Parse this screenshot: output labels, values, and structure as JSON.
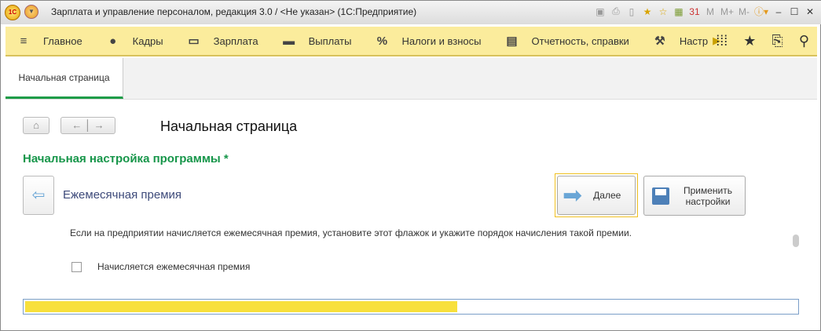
{
  "window": {
    "logo": "1С",
    "title": "Зарплата и управление персоналом, редакция 3.0 / <Не указан>  (1С:Предприятие)",
    "toolbar": [
      "M",
      "M+",
      "M-"
    ]
  },
  "sections": [
    {
      "icon": "menu-icon",
      "glyph": "≡",
      "label": "Главное"
    },
    {
      "icon": "people-icon",
      "glyph": "👥",
      "label": "Кадры"
    },
    {
      "icon": "card-icon",
      "glyph": "▭",
      "label": "Зарплата"
    },
    {
      "icon": "wallet-icon",
      "glyph": "▬",
      "label": "Выплаты"
    },
    {
      "icon": "percent-icon",
      "glyph": "%",
      "label": "Налоги и взносы"
    },
    {
      "icon": "documents-icon",
      "glyph": "▤",
      "label": "Отчетность, справки"
    },
    {
      "icon": "wrench-icon",
      "glyph": "🔧",
      "label": "Настр"
    }
  ],
  "tabs": [
    {
      "label": "Начальная страница"
    }
  ],
  "page": {
    "title": "Начальная страница",
    "form_title": "Начальная настройка программы *",
    "step_title": "Ежемесячная премия",
    "next_label": "Далее",
    "apply_label": "Применить настройки",
    "description": "Если на предприятии начисляется ежемесячная премия, установите этот флажок и укажите порядок начисления такой премии.",
    "checkbox_label": "Начисляется ежемесячная премия",
    "checkbox_checked": false
  },
  "progress": {
    "percent": 56,
    "color": "#f8e03c"
  }
}
